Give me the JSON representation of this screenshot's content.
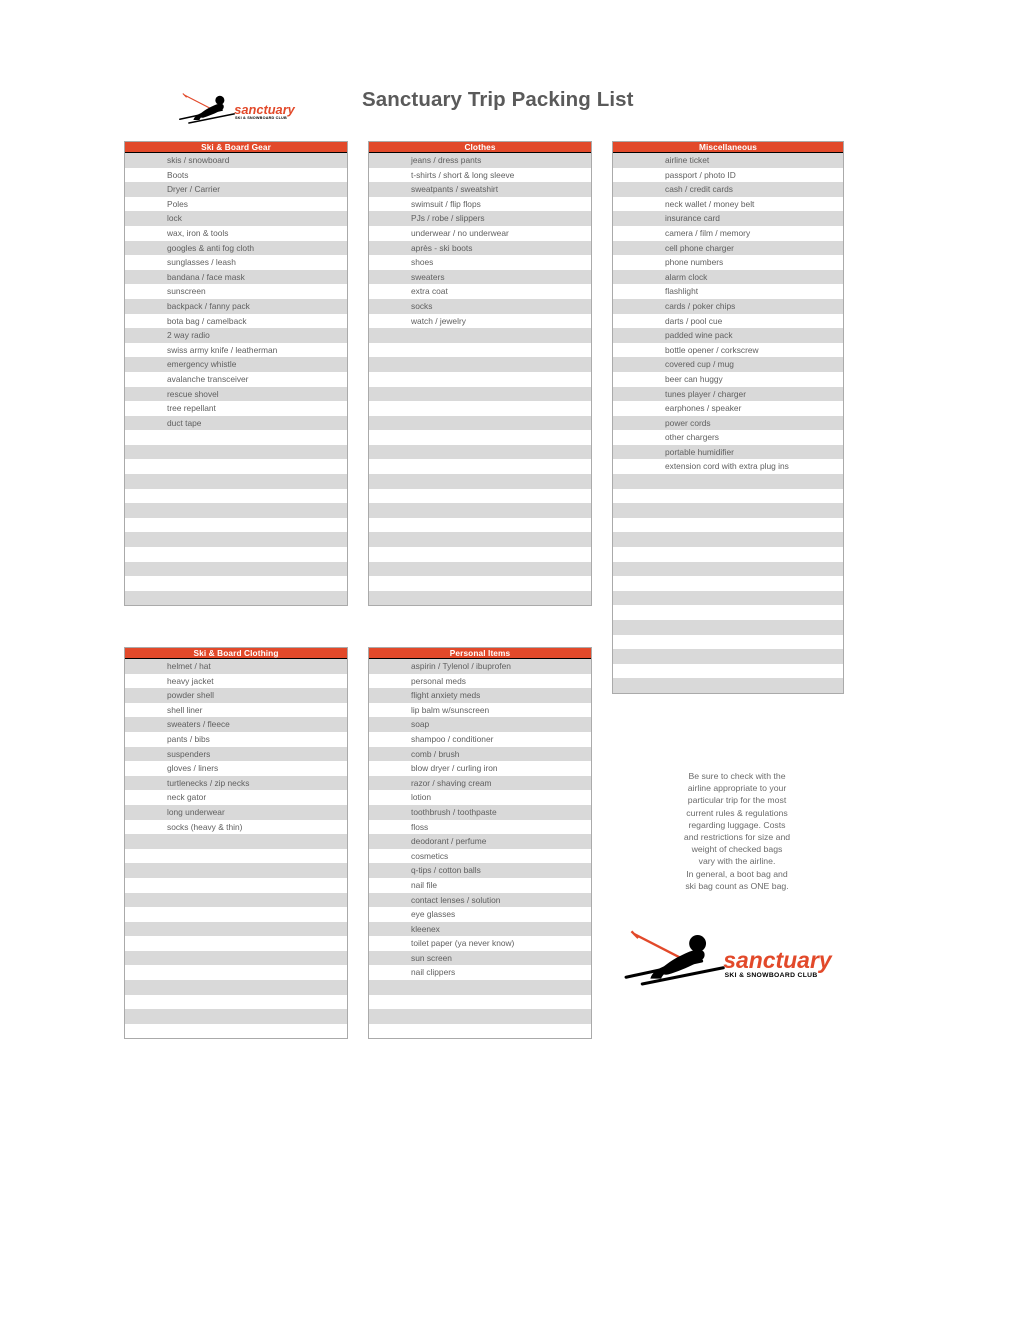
{
  "document": {
    "title": "Sanctuary Trip Packing List"
  },
  "brand": {
    "wordmark": "sanctuary",
    "tagline": "SKI & SNOWBOARD CLUB",
    "accent_color": "#e2492a",
    "silhouette_color": "#000000",
    "title_color": "#5a5a5a"
  },
  "styles": {
    "header_bg": "#e2492a",
    "header_text": "#ffffff",
    "row_alt_bg": "#d9d9d9",
    "row_plain_bg": "#ffffff",
    "row_text": "#5f5f5f",
    "table_border": "#aaaaaa"
  },
  "tables": [
    {
      "id": "gear",
      "header": "Ski & Board Gear",
      "total_rows": 31,
      "items": [
        "skis / snowboard",
        "Boots",
        "Dryer / Carrier",
        "Poles",
        "lock",
        "wax, iron & tools",
        "googles & anti fog cloth",
        "sunglasses / leash",
        "bandana / face mask",
        "sunscreen",
        "backpack / fanny pack",
        "bota bag / camelback",
        "2 way radio",
        "swiss army knife / leatherman",
        "emergency whistle",
        "avalanche transceiver",
        "rescue shovel",
        "tree repellant",
        "duct tape"
      ]
    },
    {
      "id": "clothes",
      "header": "Clothes",
      "total_rows": 31,
      "items": [
        "jeans / dress pants",
        "t-shirts / short & long sleeve",
        "sweatpants / sweatshirt",
        "swimsuit / flip flops",
        "PJs / robe / slippers",
        "underwear / no underwear",
        "après - ski boots",
        "shoes",
        "sweaters",
        "extra coat",
        "socks",
        "watch / jewelry"
      ]
    },
    {
      "id": "misc",
      "header": "Miscellaneous",
      "total_rows": 37,
      "items": [
        "airline ticket",
        "passport / photo ID",
        "cash / credit cards",
        "neck wallet / money belt",
        "insurance card",
        "camera / film / memory",
        "cell phone charger",
        "phone numbers",
        "alarm clock",
        "flashlight",
        "cards / poker chips",
        "darts / pool cue",
        "padded wine pack",
        "bottle opener / corkscrew",
        "covered cup / mug",
        "beer can huggy",
        "tunes player / charger",
        "earphones / speaker",
        "power cords",
        "other chargers",
        "portable humidifier",
        "extension cord with extra plug ins"
      ]
    },
    {
      "id": "skicloth",
      "header": "Ski & Board Clothing",
      "total_rows": 26,
      "items": [
        "helmet / hat",
        "heavy jacket",
        "powder shell",
        "shell liner",
        "sweaters / fleece",
        "pants / bibs",
        "suspenders",
        "gloves / liners",
        "turtlenecks / zip necks",
        "neck gator",
        "long underwear",
        "socks (heavy & thin)"
      ]
    },
    {
      "id": "personal",
      "header": "Personal Items",
      "total_rows": 26,
      "items": [
        "aspirin / Tylenol / ibuprofen",
        "personal meds",
        "flight anxiety meds",
        "lip balm w/sunscreen",
        "soap",
        "shampoo / conditioner",
        "comb / brush",
        "blow dryer / curling iron",
        "razor / shaving cream",
        "lotion",
        "toothbrush / toothpaste",
        "floss",
        "deodorant / perfume",
        "cosmetics",
        "q-tips / cotton balls",
        "nail file",
        "contact lenses / solution",
        "eye glasses",
        "kleenex",
        "toilet paper (ya never know)",
        "sun screen",
        "nail clippers"
      ]
    }
  ],
  "airline_note": {
    "lines": [
      "Be sure to check with the",
      "airline appropriate to your",
      "particular trip for the most",
      "current rules & regulations",
      "regarding luggage. Costs",
      "and restrictions for size and",
      "weight of checked bags",
      "vary with the airline.",
      "In general, a boot bag and",
      "ski bag count as ONE bag."
    ]
  }
}
